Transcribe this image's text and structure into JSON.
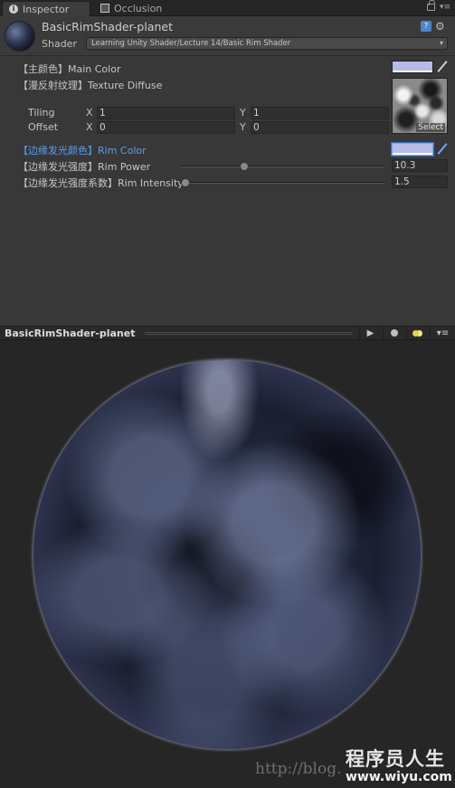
{
  "tabs": [
    {
      "label": "Inspector",
      "icon": "info-icon"
    },
    {
      "label": "Occlusion",
      "icon": "occlusion-icon"
    }
  ],
  "header": {
    "material_name": "BasicRimShader-planet",
    "shader_label": "Shader",
    "shader_value": "Learning Unity Shader/Lecture 14/Basic Rim Shader"
  },
  "properties": {
    "main_color": {
      "label": "【主颜色】Main Color",
      "color": "#b6bce6"
    },
    "texture": {
      "label": "【漫反射纹理】Texture Diffuse",
      "select_label": "Select"
    },
    "tiling": {
      "label": "Tiling",
      "x_label": "X",
      "x": "1",
      "y_label": "Y",
      "y": "1"
    },
    "offset": {
      "label": "Offset",
      "x_label": "X",
      "x": "0",
      "y_label": "Y",
      "y": "0"
    },
    "rim_color": {
      "label": "【边缘发光颜色】Rim Color",
      "color": "#b6bce6"
    },
    "rim_power": {
      "label": "【边缘发光强度】Rim Power",
      "value": "10.3",
      "slider_fraction": 0.3
    },
    "rim_intensity": {
      "label": "【边缘发光强度系数】Rim Intensity",
      "value": "1.5",
      "slider_fraction": 0.0
    }
  },
  "preview": {
    "title": "BasicRimShader-planet",
    "play_icon": "play-icon",
    "sphere_icon": "sphere-icon",
    "lights_icon": "lights-icon"
  },
  "watermark": {
    "url": "http://blog.",
    "brand": "程序员人生",
    "site": "www.wiyu.com"
  },
  "colors": {
    "accent_blue": "#5b9cf0",
    "rim": "#c4c9ef"
  }
}
